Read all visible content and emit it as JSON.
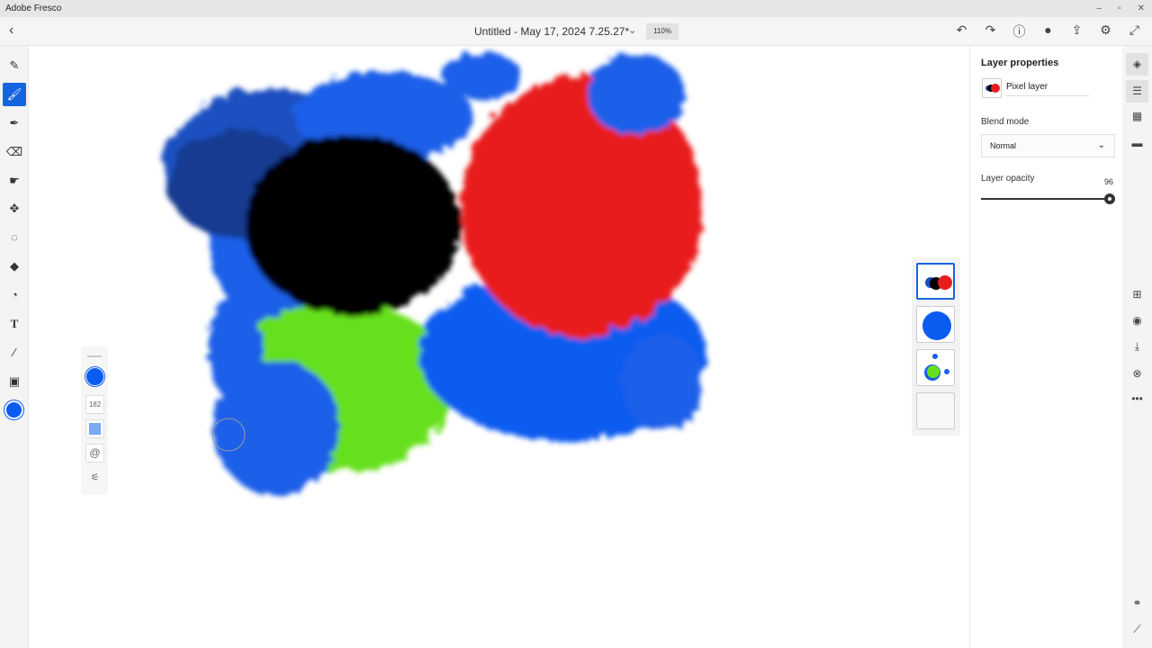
{
  "app": {
    "title": "Adobe Fresco"
  },
  "window": {
    "minimize": "–",
    "restore": "▫",
    "close": "✕"
  },
  "header": {
    "document_title": "Untitled - May 17, 2024 7.25.27*",
    "zoom": "110%"
  },
  "brush_panel": {
    "size": "182"
  },
  "layer_properties": {
    "title": "Layer properties",
    "layer_name": "Pixel layer",
    "blend_label": "Blend mode",
    "blend_value": "Normal",
    "opacity_label": "Layer opacity",
    "opacity_value": "96",
    "opacity_percent": 96
  },
  "colors": {
    "accent": "#1565e0",
    "current_color": "#0a5cf0"
  }
}
